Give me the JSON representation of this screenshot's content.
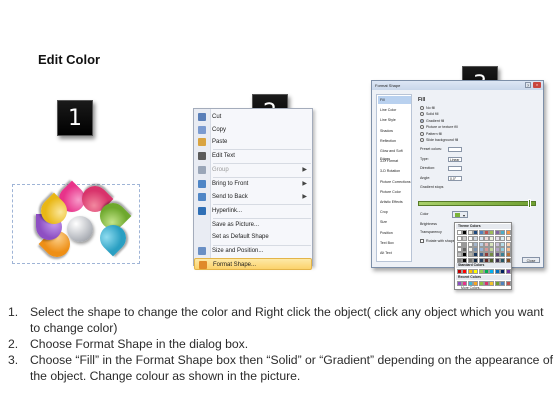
{
  "title": "Edit Color",
  "badges": [
    "1",
    "2",
    "3"
  ],
  "context_menu": {
    "items": [
      {
        "label": "Cut",
        "icon": "scissors-icon",
        "disabled": false,
        "submenu": false
      },
      {
        "label": "Copy",
        "icon": "copy-icon",
        "disabled": false,
        "submenu": false
      },
      {
        "label": "Paste",
        "icon": "paste-icon",
        "disabled": false,
        "submenu": false
      },
      {
        "label": "Edit Text",
        "icon": "edit-text-icon",
        "disabled": false,
        "submenu": false
      },
      {
        "label": "Group",
        "icon": "group-icon",
        "disabled": true,
        "submenu": true
      },
      {
        "label": "Bring to Front",
        "icon": "bring-front-icon",
        "disabled": false,
        "submenu": true
      },
      {
        "label": "Send to Back",
        "icon": "send-back-icon",
        "disabled": false,
        "submenu": true
      },
      {
        "label": "Hyperlink...",
        "icon": "hyperlink-icon",
        "disabled": false,
        "submenu": false
      },
      {
        "label": "Save as Picture...",
        "icon": "",
        "disabled": false,
        "submenu": false
      },
      {
        "label": "Set as Default Shape",
        "icon": "",
        "disabled": false,
        "submenu": false
      },
      {
        "label": "Size and Position...",
        "icon": "size-icon",
        "disabled": false,
        "submenu": false
      },
      {
        "label": "Format Shape...",
        "icon": "format-shape-icon",
        "disabled": false,
        "submenu": false,
        "highlighted": true
      }
    ]
  },
  "format_dialog": {
    "title": "Format Shape",
    "sidebar": [
      "Fill",
      "Line Color",
      "Line Style",
      "Shadow",
      "Reflection",
      "Glow and Soft Edges",
      "3-D Format",
      "3-D Rotation",
      "Picture Corrections",
      "Picture Color",
      "Artistic Effects",
      "Crop",
      "Size",
      "Position",
      "Text Box",
      "Alt Text"
    ],
    "fill_header": "Fill",
    "fill_options": [
      "No fill",
      "Solid fill",
      "Gradient fill",
      "Picture or texture fill",
      "Pattern fill",
      "Slide background fill"
    ],
    "selected_fill": 2,
    "fields": [
      {
        "label": "Preset colors:",
        "value": ""
      },
      {
        "label": "Type:",
        "value": "Linear"
      },
      {
        "label": "Direction:",
        "value": ""
      },
      {
        "label": "Angle:",
        "value": "0.0°"
      },
      {
        "label": "Gradient stops",
        "value": ""
      }
    ],
    "color_label": "Color",
    "brightness_label": "Brightness",
    "transparency_label": "Transparency",
    "rotate_label": "Rotate with shape",
    "close_label": "Close"
  },
  "palette": {
    "theme_label": "Theme Colors",
    "standard_label": "Standard Colors",
    "recent_label": "Recent Colors",
    "more_label": "More Colors..."
  },
  "steps": [
    {
      "n": "1.",
      "text": "Select the shape to change the color and Right click the object( click any object which you want to change color)"
    },
    {
      "n": "2.",
      "text": "Choose Format Shape in the dialog box."
    },
    {
      "n": "3.",
      "text": "Choose “Fill” in the Format Shape box then “Solid” or “Gradient” depending on the appearance of the object. Change colour as shown in the picture."
    }
  ],
  "colors": {
    "badge_bg": "#000000",
    "highlight": "#fbd26b",
    "petals": [
      "#e8338a",
      "#d8336b",
      "#8bc540",
      "#3cb7d6",
      "#f5a524",
      "#8e4fc3",
      "#f2c22c"
    ]
  }
}
